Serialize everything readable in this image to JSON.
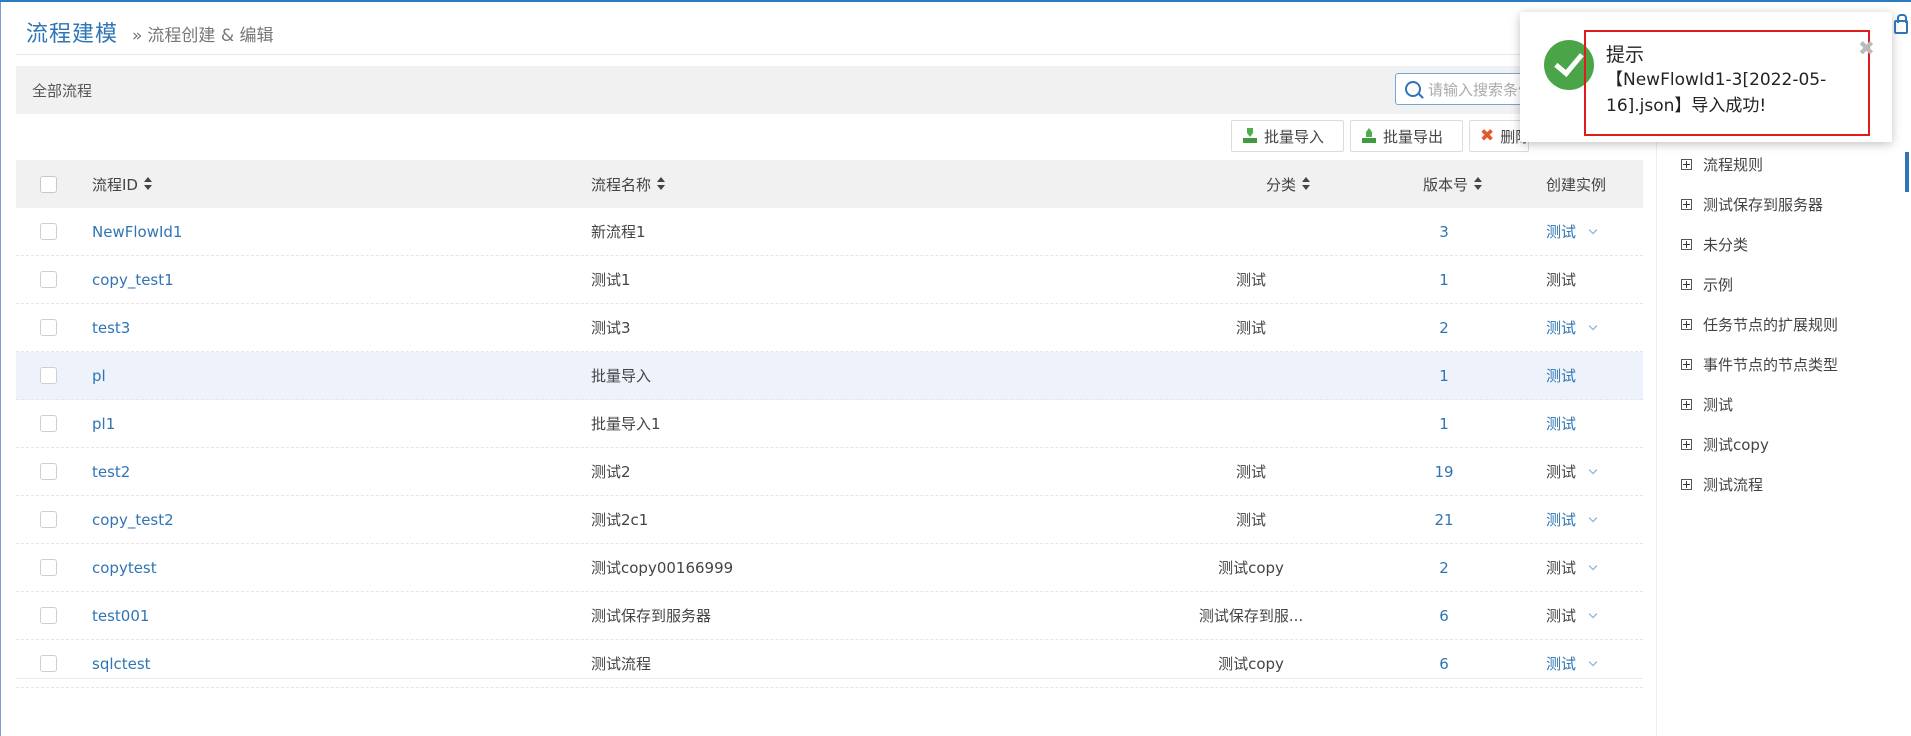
{
  "header": {
    "title": "流程建模",
    "separator": "»",
    "subtitle": "流程创建 & 编辑"
  },
  "toolbar": {
    "all_label": "全部流程",
    "search_placeholder": "请输入搜索条件",
    "buttons": {
      "import": "批量导入",
      "export": "批量导出",
      "delete": "删除版本"
    }
  },
  "table": {
    "columns": {
      "id": "流程ID",
      "name": "流程名称",
      "category": "分类",
      "version": "版本号",
      "instance": "创建实例"
    },
    "rows": [
      {
        "id": "NewFlowId1",
        "name": "新流程1",
        "category": "",
        "version": "3",
        "instance": "测试",
        "instance_link": true,
        "dropdown": true,
        "highlight": false
      },
      {
        "id": "copy_test1",
        "name": "测试1",
        "category": "测试",
        "version": "1",
        "instance": "测试",
        "instance_link": false,
        "dropdown": false,
        "highlight": false
      },
      {
        "id": "test3",
        "name": "测试3",
        "category": "测试",
        "version": "2",
        "instance": "测试",
        "instance_link": true,
        "dropdown": true,
        "highlight": false
      },
      {
        "id": "pl",
        "name": "批量导入",
        "category": "",
        "version": "1",
        "instance": "测试",
        "instance_link": true,
        "dropdown": false,
        "highlight": true
      },
      {
        "id": "pl1",
        "name": "批量导入1",
        "category": "",
        "version": "1",
        "instance": "测试",
        "instance_link": true,
        "dropdown": false,
        "highlight": false
      },
      {
        "id": "test2",
        "name": "测试2",
        "category": "测试",
        "version": "19",
        "instance": "测试",
        "instance_link": false,
        "dropdown": true,
        "highlight": false
      },
      {
        "id": "copy_test2",
        "name": "测试2c1",
        "category": "测试",
        "version": "21",
        "instance": "测试",
        "instance_link": true,
        "dropdown": true,
        "highlight": false
      },
      {
        "id": "copytest",
        "name": "测试copy00166999",
        "category": "测试copy",
        "version": "2",
        "instance": "测试",
        "instance_link": false,
        "dropdown": true,
        "highlight": false
      },
      {
        "id": "test001",
        "name": "测试保存到服务器",
        "category": "测试保存到服...",
        "version": "6",
        "instance": "测试",
        "instance_link": false,
        "dropdown": true,
        "highlight": false
      },
      {
        "id": "sqlctest",
        "name": "测试流程",
        "category": "测试copy",
        "version": "6",
        "instance": "测试",
        "instance_link": true,
        "dropdown": true,
        "highlight": false
      }
    ]
  },
  "tree": {
    "items": [
      {
        "label": "流程规则"
      },
      {
        "label": "测试保存到服务器"
      },
      {
        "label": "未分类"
      },
      {
        "label": "示例"
      },
      {
        "label": "任务节点的扩展规则"
      },
      {
        "label": "事件节点的节点类型"
      },
      {
        "label": "测试"
      },
      {
        "label": "测试copy"
      },
      {
        "label": "测试流程"
      }
    ]
  },
  "toast": {
    "title": "提示",
    "message": "【NewFlowId1-3[2022-05-16].json】导入成功!",
    "close": "✖"
  },
  "colors": {
    "link": "#2f75b5",
    "success": "#49a547",
    "highlight_box": "#e01b1b",
    "delete_icon": "#e25a2b"
  },
  "icons": {
    "toast": "check-circle-icon",
    "tree": "plus-square-icon",
    "search": "search-icon"
  }
}
